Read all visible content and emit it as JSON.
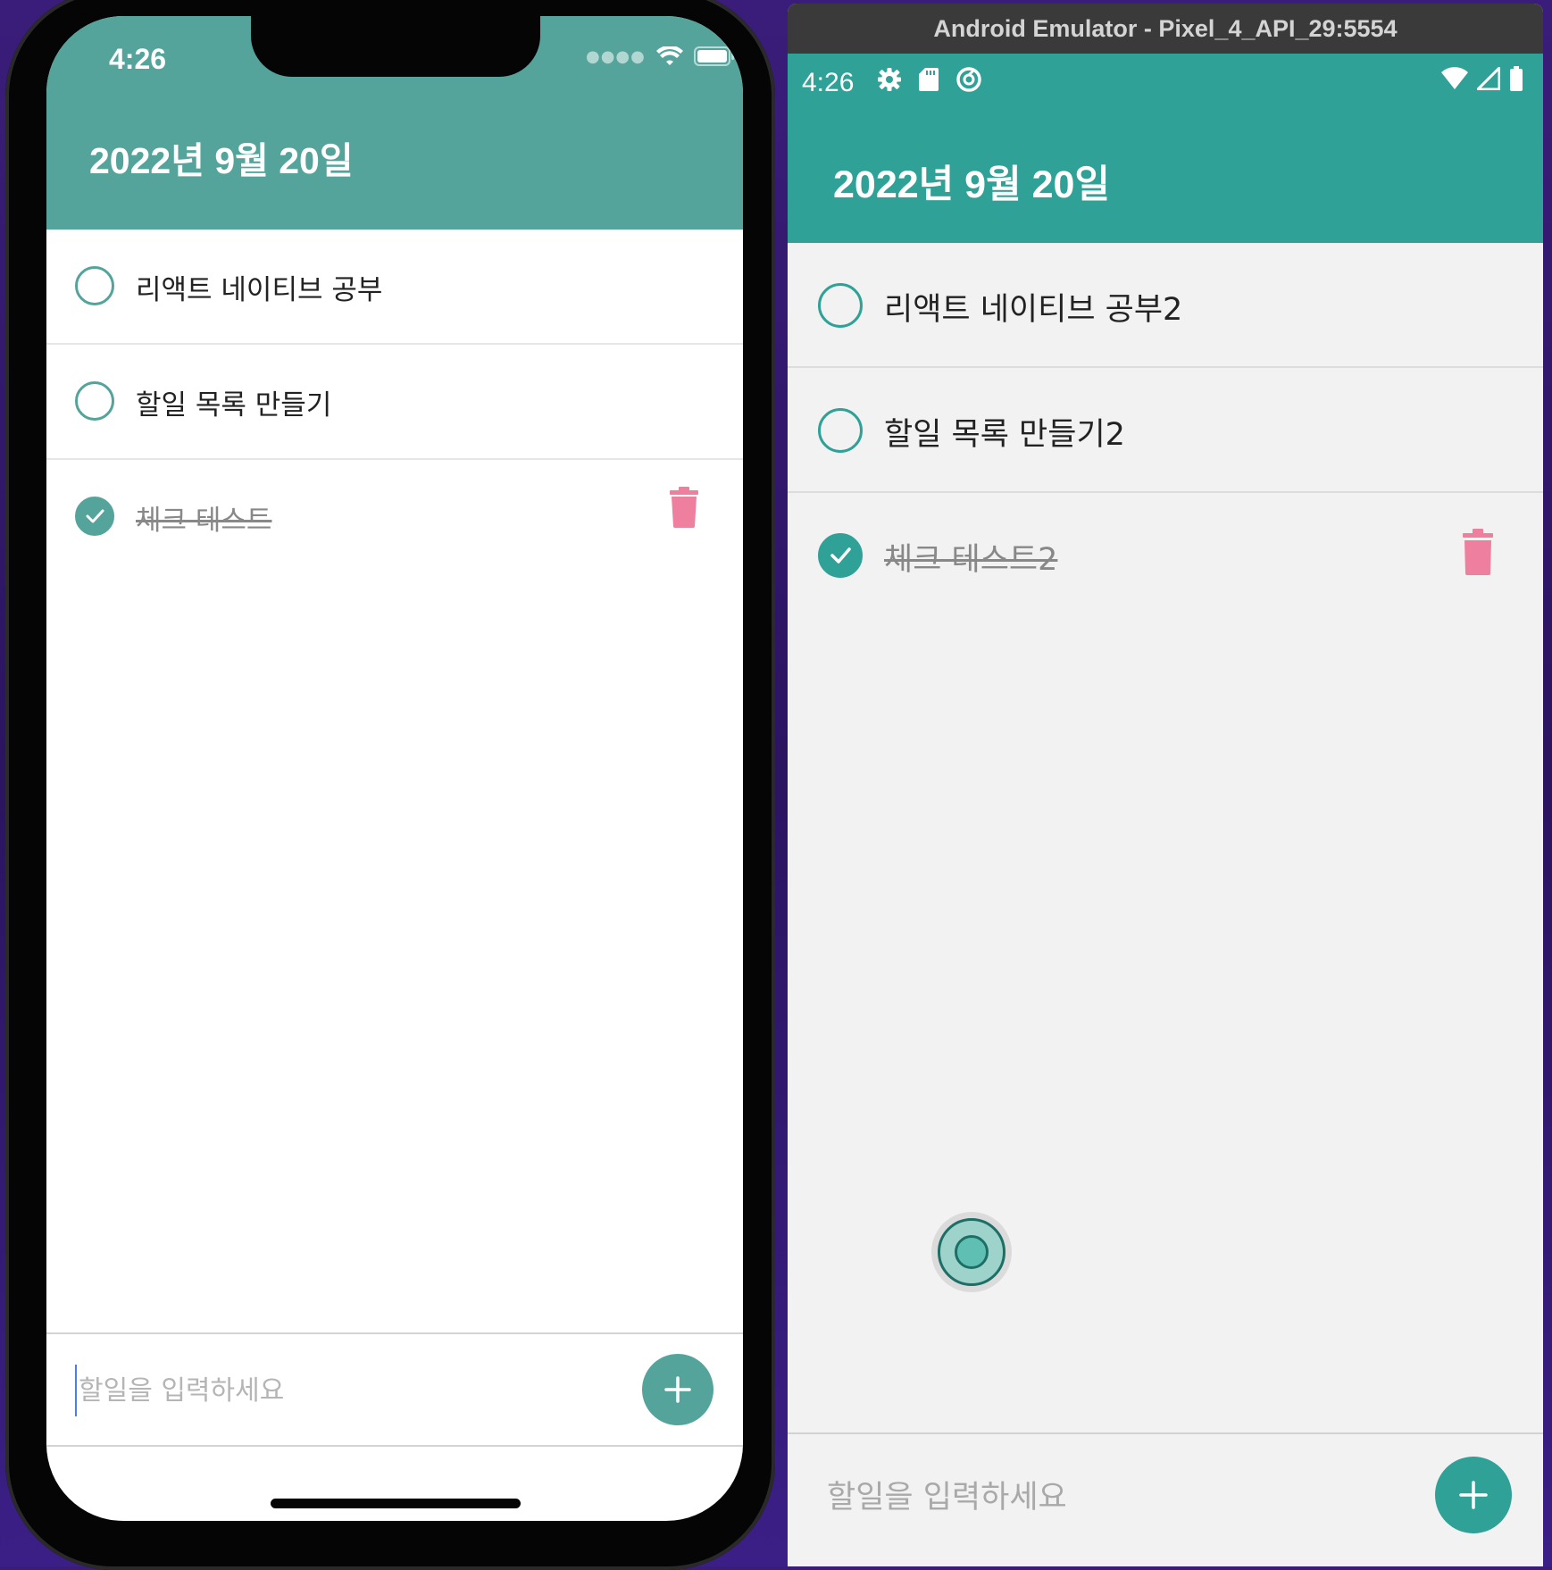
{
  "theme": {
    "ios_accent": "#54a49b",
    "android_accent": "#30a196",
    "delete_color": "#ef7f9e"
  },
  "ios": {
    "status": {
      "time": "4:26"
    },
    "date_title": "2022년 9월 20일",
    "todos": [
      {
        "text": "리액트 네이티브 공부",
        "done": false
      },
      {
        "text": "할일 목록 만들기",
        "done": false
      },
      {
        "text": "체크 테스트",
        "done": true
      }
    ],
    "input": {
      "placeholder": "할일을 입력하세요",
      "value": ""
    }
  },
  "android": {
    "window_title": "Android Emulator - Pixel_4_API_29:5554",
    "status": {
      "time": "4:26"
    },
    "date_title": "2022년 9월 20일",
    "todos": [
      {
        "text": "리액트 네이티브 공부2",
        "done": false
      },
      {
        "text": "할일 목록 만들기2",
        "done": false
      },
      {
        "text": "체크 테스트2",
        "done": true
      }
    ],
    "input": {
      "placeholder": "할일을 입력하세요",
      "value": ""
    }
  },
  "icons": {
    "status_left": [
      "settings-icon",
      "sd-card-icon",
      "sync-icon"
    ],
    "status_right": [
      "wifi-icon",
      "signal-icon",
      "battery-icon"
    ],
    "item_action": "trash-icon",
    "add_button": "plus-icon",
    "check": "check-icon"
  }
}
